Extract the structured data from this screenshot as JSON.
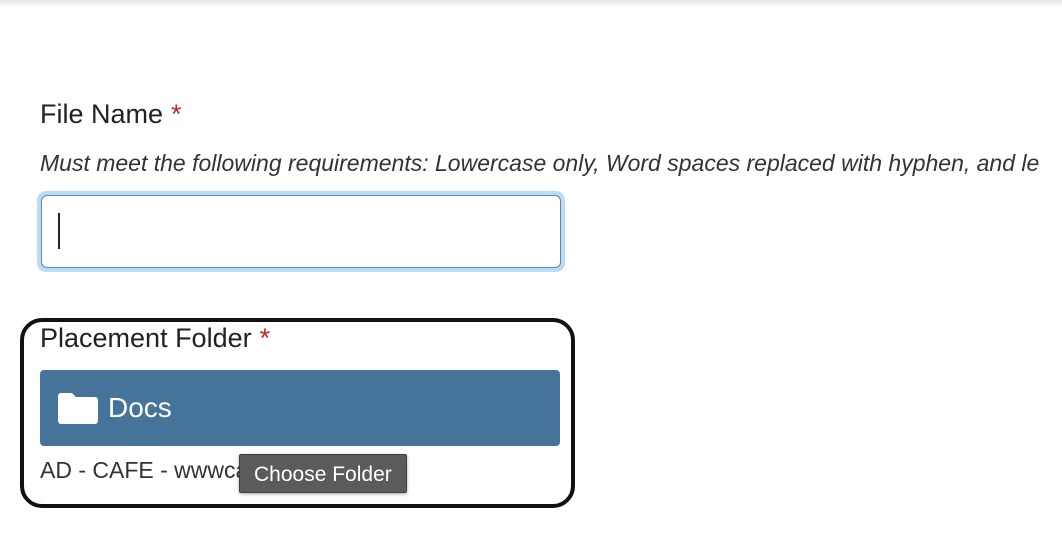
{
  "file_name_field": {
    "label": "File Name",
    "required_mark": "*",
    "help_text": "Must meet the following requirements: Lowercase only, Word spaces replaced with hyphen, and le",
    "value": "",
    "placeholder": ""
  },
  "placement_folder_field": {
    "label": "Placement Folder",
    "required_mark": "*",
    "button": {
      "icon": "folder-icon",
      "folder_name": "Docs"
    },
    "path_text": "AD - CAFE - wwwca",
    "tooltip": "Choose Folder"
  },
  "colors": {
    "button_bg": "#45739a",
    "required_star": "#c0282d",
    "focus_ring": "#b9dcf8",
    "tooltip_bg": "#5b5b5b"
  }
}
